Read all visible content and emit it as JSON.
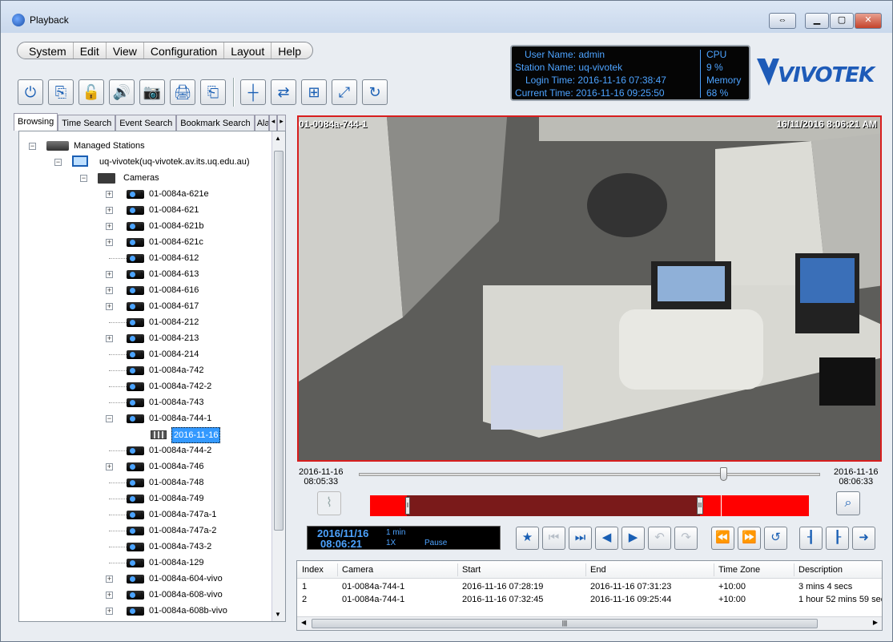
{
  "window": {
    "title": "Playback",
    "buttons": {
      "restore_alt": "⇔",
      "minimize": "▁",
      "maximize": "▢",
      "close": "✕"
    }
  },
  "menu": [
    "System",
    "Edit",
    "View",
    "Configuration",
    "Layout",
    "Help"
  ],
  "toolbar": {
    "left": [
      {
        "icon": "power-icon",
        "glyph": "⏻"
      },
      {
        "icon": "export-icon",
        "glyph": "⎘"
      },
      {
        "icon": "lock-icon",
        "glyph": "🔓"
      },
      {
        "icon": "audio-icon",
        "glyph": "🔊"
      },
      {
        "icon": "snapshot-icon",
        "glyph": "📷"
      },
      {
        "icon": "print-icon",
        "glyph": "🖨"
      },
      {
        "icon": "backup-icon",
        "glyph": "⎗"
      }
    ],
    "right": [
      {
        "icon": "search-timeline-icon",
        "glyph": "┼"
      },
      {
        "icon": "sync-icon",
        "glyph": "⇄"
      },
      {
        "icon": "layout-icon",
        "glyph": "⊞"
      },
      {
        "icon": "fullscreen-icon",
        "glyph": "⤢"
      },
      {
        "icon": "refresh-icon",
        "glyph": "↻"
      }
    ]
  },
  "status": {
    "user_label": "User Name:",
    "user": "admin",
    "station_label": "Station Name:",
    "station": "uq-vivotek",
    "login_label": "Login Time:",
    "login": "2016-11-16 07:38:47",
    "current_label": "Current Time:",
    "current": "2016-11-16 09:25:50",
    "cpu_label": "CPU",
    "cpu": "9 %",
    "memory_label": "Memory",
    "memory": "68 %"
  },
  "logo": {
    "text": "VIVOTEK",
    "color": "#1e5bb8"
  },
  "tabs": [
    "Browsing",
    "Time Search",
    "Event Search",
    "Bookmark Search",
    "Ala"
  ],
  "tree": {
    "root": "Managed Stations",
    "station": "uq-vivotek(uq-vivotek.av.its.uq.edu.au)",
    "group": "Cameras",
    "cameras": [
      {
        "name": "01-0084a-621e",
        "expandable": true
      },
      {
        "name": "01-0084-621",
        "expandable": true
      },
      {
        "name": "01-0084-621b",
        "expandable": true
      },
      {
        "name": "01-0084-621c",
        "expandable": true
      },
      {
        "name": "01-0084-612",
        "expandable": false
      },
      {
        "name": "01-0084-613",
        "expandable": true
      },
      {
        "name": "01-0084-616",
        "expandable": true
      },
      {
        "name": "01-0084-617",
        "expandable": true
      },
      {
        "name": "01-0084-212",
        "expandable": false
      },
      {
        "name": "01-0084-213",
        "expandable": true
      },
      {
        "name": "01-0084-214",
        "expandable": false
      },
      {
        "name": "01-0084a-742",
        "expandable": false
      },
      {
        "name": "01-0084a-742-2",
        "expandable": false
      },
      {
        "name": "01-0084a-743",
        "expandable": false
      },
      {
        "name": "01-0084a-744-1",
        "expandable": true,
        "expanded": true
      },
      {
        "name": "01-0084a-744-2",
        "expandable": false
      },
      {
        "name": "01-0084a-746",
        "expandable": true
      },
      {
        "name": "01-0084a-748",
        "expandable": false
      },
      {
        "name": "01-0084a-749",
        "expandable": false
      },
      {
        "name": "01-0084a-747a-1",
        "expandable": false
      },
      {
        "name": "01-0084a-747a-2",
        "expandable": false
      },
      {
        "name": "01-0084a-743-2",
        "expandable": false
      },
      {
        "name": "01-0084a-129",
        "expandable": false
      },
      {
        "name": "01-0084a-604-vivo",
        "expandable": true
      },
      {
        "name": "01-0084a-608-vivo",
        "expandable": true
      },
      {
        "name": "01-0084a-608b-vivo",
        "expandable": true
      }
    ],
    "selected_date": "2016-11-16"
  },
  "video": {
    "camera_label": "01-0084a-744-1",
    "timestamp": "16/11/2016 8:06:21 AM",
    "border_color": "#d81e1e"
  },
  "timeline": {
    "start_date": "2016-11-16",
    "start_time": "08:05:33",
    "end_date": "2016-11-16",
    "end_time": "08:06:33",
    "slider_position": 0.79,
    "marker_i": "I",
    "marker_ii": "II"
  },
  "playback": {
    "date": "2016/11/16",
    "time": "08:06:21",
    "interval": "1 min",
    "speed": "1X",
    "state": "Pause"
  },
  "controls": [
    {
      "icon": "bookmark-star-icon",
      "glyph": "★",
      "enabled": true
    },
    {
      "icon": "go-start-icon",
      "glyph": "⏮",
      "enabled": false
    },
    {
      "icon": "next-frame-icon",
      "glyph": "⏭",
      "enabled": true
    },
    {
      "icon": "reverse-play-icon",
      "glyph": "◀",
      "enabled": true
    },
    {
      "icon": "play-icon",
      "glyph": "▶",
      "enabled": true
    },
    {
      "icon": "slow-icon",
      "glyph": "↶",
      "enabled": false
    },
    {
      "icon": "fast-icon",
      "glyph": "↷",
      "enabled": false
    },
    {
      "icon": "prev-event-icon",
      "glyph": "⏪",
      "enabled": false
    },
    {
      "icon": "next-event-icon",
      "glyph": "⏩",
      "enabled": false
    },
    {
      "icon": "loop-icon",
      "glyph": "↺",
      "enabled": true
    },
    {
      "icon": "mark-in-icon",
      "glyph": "┨",
      "enabled": true
    },
    {
      "icon": "mark-out-icon",
      "glyph": "┠",
      "enabled": true
    },
    {
      "icon": "export-clip-icon",
      "glyph": "➜",
      "enabled": true
    }
  ],
  "results": {
    "columns": [
      "Index",
      "Camera",
      "Start",
      "End",
      "Time Zone",
      "Description"
    ],
    "rows": [
      [
        "1",
        "01-0084a-744-1",
        "2016-11-16 07:28:19",
        "2016-11-16 07:31:23",
        "+10:00",
        "3 mins 4 secs"
      ],
      [
        "2",
        "01-0084a-744-1",
        "2016-11-16 07:32:45",
        "2016-11-16 09:25:44",
        "+10:00",
        "1 hour 52 mins 59 sec"
      ]
    ]
  }
}
